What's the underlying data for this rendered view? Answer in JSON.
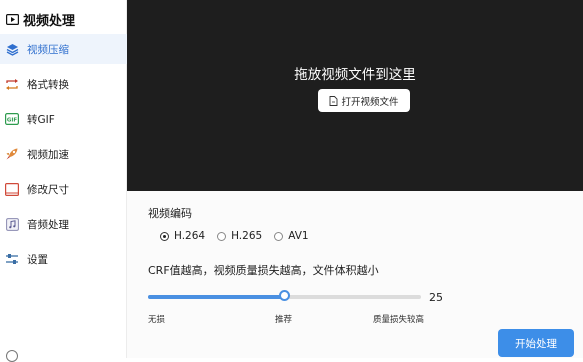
{
  "app": {
    "title": "视频处理"
  },
  "sidebar": {
    "items": [
      {
        "label": "视频压缩",
        "icon": "layers-icon",
        "active": true
      },
      {
        "label": "格式转换",
        "icon": "convert-arrows-icon",
        "active": false
      },
      {
        "label": "转GIF",
        "icon": "gif-icon",
        "active": false
      },
      {
        "label": "视频加速",
        "icon": "rocket-icon",
        "active": false
      },
      {
        "label": "修改尺寸",
        "icon": "resize-icon",
        "active": false
      },
      {
        "label": "音频处理",
        "icon": "music-note-icon",
        "active": false
      },
      {
        "label": "设置",
        "icon": "settings-sliders-icon",
        "active": false
      }
    ]
  },
  "dropzone": {
    "prompt": "拖放视频文件到这里",
    "open_button": "打开视频文件"
  },
  "settings": {
    "codec_label": "视频编码",
    "codecs": [
      {
        "label": "H.264",
        "checked": true
      },
      {
        "label": "H.265",
        "checked": false
      },
      {
        "label": "AV1",
        "checked": false
      }
    ],
    "crf_hint": "CRF值越高，视频质量损失越高，文件体积越小",
    "crf": {
      "value": "25",
      "min": 0,
      "max": 51,
      "fraction": 0.5
    },
    "ticks": {
      "left": "无损",
      "middle": "推荐",
      "right": "质量损失较高"
    },
    "start_button": "开始处理"
  },
  "colors": {
    "accent": "#4a90e2",
    "button": "#3d8ee8",
    "dropzone_bg": "#1e1e1e",
    "active_bg": "#eef4fc"
  }
}
